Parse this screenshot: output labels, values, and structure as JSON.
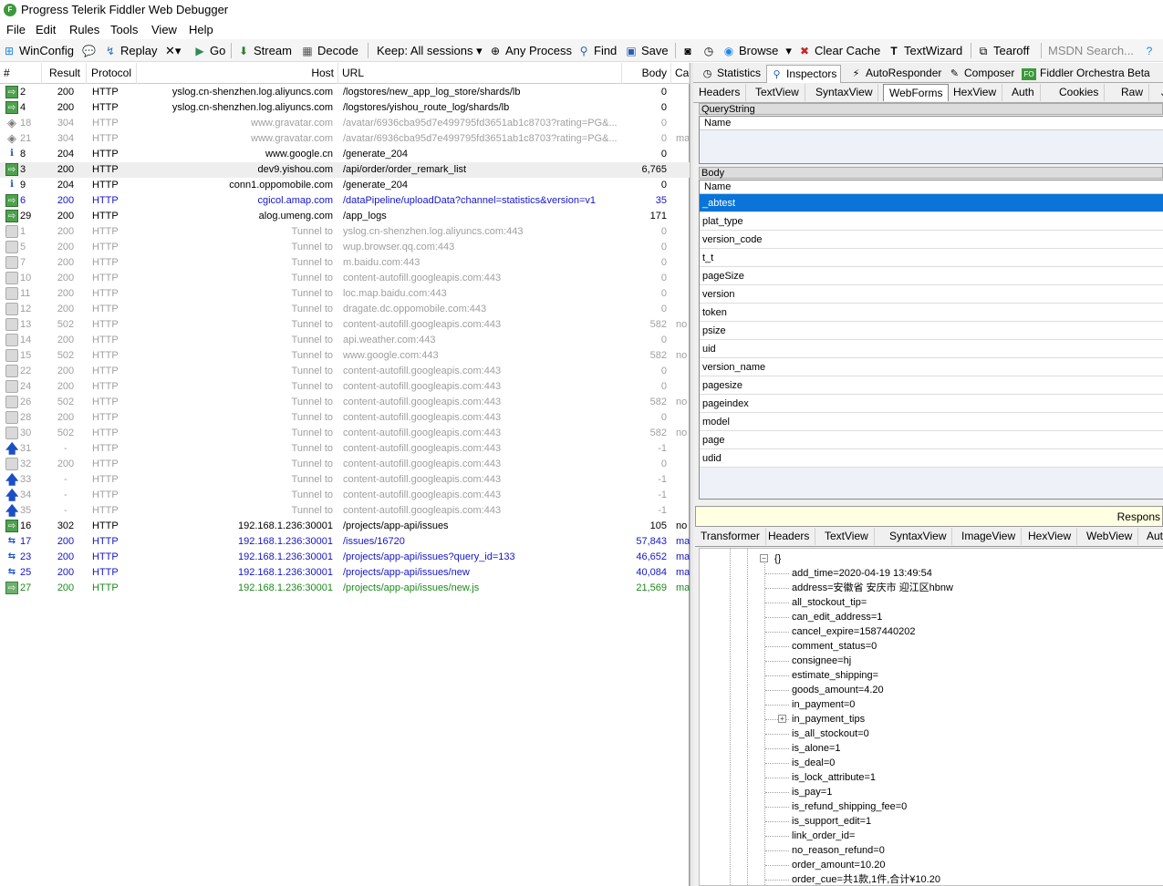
{
  "window": {
    "title": "Progress Telerik Fiddler Web Debugger",
    "icon": "F"
  },
  "menu": [
    "File",
    "Edit",
    "Rules",
    "Tools",
    "View",
    "Help"
  ],
  "toolbar": {
    "winconfig": "WinConfig",
    "replay": "Replay",
    "remove": "✕▾",
    "go": "Go",
    "stream": "Stream",
    "decode": "Decode",
    "keep": "Keep: All sessions ▾",
    "any_process": "Any Process",
    "find": "Find",
    "save": "Save",
    "browse": "Browse",
    "clear_cache": "Clear Cache",
    "textwizard": "TextWizard",
    "tearoff": "Tearoff",
    "msdn_search": "MSDN Search..."
  },
  "session_columns": [
    "#",
    "Result",
    "Protocol",
    "Host",
    "URL",
    "Body",
    "Ca"
  ],
  "sessions": [
    {
      "icon": "ok",
      "num": "2",
      "result": "200",
      "protocol": "HTTP",
      "host": "yslog.cn-shenzhen.log.aliyuncs.com",
      "url": "/logstores/new_app_log_store/shards/lb",
      "body": "0",
      "ca": "",
      "style": ""
    },
    {
      "icon": "ok",
      "num": "4",
      "result": "200",
      "protocol": "HTTP",
      "host": "yslog.cn-shenzhen.log.aliyuncs.com",
      "url": "/logstores/yishou_route_log/shards/lb",
      "body": "0",
      "ca": "",
      "style": ""
    },
    {
      "icon": "diamond",
      "num": "18",
      "result": "304",
      "protocol": "HTTP",
      "host": "www.gravatar.com",
      "url": "/avatar/6936cba95d7e499795fd3651ab1c8703?rating=PG&...",
      "body": "0",
      "ca": "",
      "style": "gray"
    },
    {
      "icon": "diamond",
      "num": "21",
      "result": "304",
      "protocol": "HTTP",
      "host": "www.gravatar.com",
      "url": "/avatar/6936cba95d7e499795fd3651ab1c8703?rating=PG&...",
      "body": "0",
      "ca": "ma",
      "style": "gray"
    },
    {
      "icon": "info",
      "num": "8",
      "result": "204",
      "protocol": "HTTP",
      "host": "www.google.cn",
      "url": "/generate_204",
      "body": "0",
      "ca": "",
      "style": ""
    },
    {
      "icon": "ok",
      "num": "3",
      "result": "200",
      "protocol": "HTTP",
      "host": "dev9.yishou.com",
      "url": "/api/order/order_remark_list",
      "body": "6,765",
      "ca": "",
      "style": "",
      "selected": true
    },
    {
      "icon": "info",
      "num": "9",
      "result": "204",
      "protocol": "HTTP",
      "host": "conn1.oppomobile.com",
      "url": "/generate_204",
      "body": "0",
      "ca": "",
      "style": ""
    },
    {
      "icon": "ok",
      "num": "6",
      "result": "200",
      "protocol": "HTTP",
      "host": "cgicol.amap.com",
      "url": "/dataPipeline/uploadData?channel=statistics&version=v1",
      "body": "35",
      "ca": "",
      "style": "blue"
    },
    {
      "icon": "ok",
      "num": "29",
      "result": "200",
      "protocol": "HTTP",
      "host": "alog.umeng.com",
      "url": "/app_logs",
      "body": "171",
      "ca": "",
      "style": ""
    },
    {
      "icon": "lock",
      "num": "1",
      "result": "200",
      "protocol": "HTTP",
      "host": "Tunnel to",
      "url": "yslog.cn-shenzhen.log.aliyuncs.com:443",
      "body": "0",
      "ca": "",
      "style": "gray"
    },
    {
      "icon": "lock",
      "num": "5",
      "result": "200",
      "protocol": "HTTP",
      "host": "Tunnel to",
      "url": "wup.browser.qq.com:443",
      "body": "0",
      "ca": "",
      "style": "gray"
    },
    {
      "icon": "lock",
      "num": "7",
      "result": "200",
      "protocol": "HTTP",
      "host": "Tunnel to",
      "url": "m.baidu.com:443",
      "body": "0",
      "ca": "",
      "style": "gray"
    },
    {
      "icon": "lock",
      "num": "10",
      "result": "200",
      "protocol": "HTTP",
      "host": "Tunnel to",
      "url": "content-autofill.googleapis.com:443",
      "body": "0",
      "ca": "",
      "style": "gray"
    },
    {
      "icon": "lock",
      "num": "11",
      "result": "200",
      "protocol": "HTTP",
      "host": "Tunnel to",
      "url": "loc.map.baidu.com:443",
      "body": "0",
      "ca": "",
      "style": "gray"
    },
    {
      "icon": "lock",
      "num": "12",
      "result": "200",
      "protocol": "HTTP",
      "host": "Tunnel to",
      "url": "dragate.dc.oppomobile.com:443",
      "body": "0",
      "ca": "",
      "style": "gray"
    },
    {
      "icon": "lock",
      "num": "13",
      "result": "502",
      "protocol": "HTTP",
      "host": "Tunnel to",
      "url": "content-autofill.googleapis.com:443",
      "body": "582",
      "ca": "no",
      "style": "gray"
    },
    {
      "icon": "lock",
      "num": "14",
      "result": "200",
      "protocol": "HTTP",
      "host": "Tunnel to",
      "url": "api.weather.com:443",
      "body": "0",
      "ca": "",
      "style": "gray"
    },
    {
      "icon": "lock",
      "num": "15",
      "result": "502",
      "protocol": "HTTP",
      "host": "Tunnel to",
      "url": "www.google.com:443",
      "body": "582",
      "ca": "no",
      "style": "gray"
    },
    {
      "icon": "lock",
      "num": "22",
      "result": "200",
      "protocol": "HTTP",
      "host": "Tunnel to",
      "url": "content-autofill.googleapis.com:443",
      "body": "0",
      "ca": "",
      "style": "gray"
    },
    {
      "icon": "lock",
      "num": "24",
      "result": "200",
      "protocol": "HTTP",
      "host": "Tunnel to",
      "url": "content-autofill.googleapis.com:443",
      "body": "0",
      "ca": "",
      "style": "gray"
    },
    {
      "icon": "lock",
      "num": "26",
      "result": "502",
      "protocol": "HTTP",
      "host": "Tunnel to",
      "url": "content-autofill.googleapis.com:443",
      "body": "582",
      "ca": "no",
      "style": "gray"
    },
    {
      "icon": "lock",
      "num": "28",
      "result": "200",
      "protocol": "HTTP",
      "host": "Tunnel to",
      "url": "content-autofill.googleapis.com:443",
      "body": "0",
      "ca": "",
      "style": "gray"
    },
    {
      "icon": "lock",
      "num": "30",
      "result": "502",
      "protocol": "HTTP",
      "host": "Tunnel to",
      "url": "content-autofill.googleapis.com:443",
      "body": "582",
      "ca": "no",
      "style": "gray"
    },
    {
      "icon": "up",
      "num": "31",
      "result": "-",
      "protocol": "HTTP",
      "host": "Tunnel to",
      "url": "content-autofill.googleapis.com:443",
      "body": "-1",
      "ca": "",
      "style": "gray"
    },
    {
      "icon": "lock",
      "num": "32",
      "result": "200",
      "protocol": "HTTP",
      "host": "Tunnel to",
      "url": "content-autofill.googleapis.com:443",
      "body": "0",
      "ca": "",
      "style": "gray"
    },
    {
      "icon": "up",
      "num": "33",
      "result": "-",
      "protocol": "HTTP",
      "host": "Tunnel to",
      "url": "content-autofill.googleapis.com:443",
      "body": "-1",
      "ca": "",
      "style": "gray"
    },
    {
      "icon": "up",
      "num": "34",
      "result": "-",
      "protocol": "HTTP",
      "host": "Tunnel to",
      "url": "content-autofill.googleapis.com:443",
      "body": "-1",
      "ca": "",
      "style": "gray"
    },
    {
      "icon": "up",
      "num": "35",
      "result": "-",
      "protocol": "HTTP",
      "host": "Tunnel to",
      "url": "content-autofill.googleapis.com:443",
      "body": "-1",
      "ca": "",
      "style": "gray"
    },
    {
      "icon": "ok",
      "num": "16",
      "result": "302",
      "protocol": "HTTP",
      "host": "192.168.1.236:30001",
      "url": "/projects/app-api/issues",
      "body": "105",
      "ca": "no",
      "style": ""
    },
    {
      "icon": "css",
      "num": "17",
      "result": "200",
      "protocol": "HTTP",
      "host": "192.168.1.236:30001",
      "url": "/issues/16720",
      "body": "57,843",
      "ca": "ma",
      "style": "blue"
    },
    {
      "icon": "css",
      "num": "23",
      "result": "200",
      "protocol": "HTTP",
      "host": "192.168.1.236:30001",
      "url": "/projects/app-api/issues?query_id=133",
      "body": "46,652",
      "ca": "ma",
      "style": "blue"
    },
    {
      "icon": "css",
      "num": "25",
      "result": "200",
      "protocol": "HTTP",
      "host": "192.168.1.236:30001",
      "url": "/projects/app-api/issues/new",
      "body": "40,084",
      "ca": "ma",
      "style": "blue"
    },
    {
      "icon": "js",
      "num": "27",
      "result": "200",
      "protocol": "HTTP",
      "host": "192.168.1.236:30001",
      "url": "/projects/app-api/issues/new.js",
      "body": "21,569",
      "ca": "ma",
      "style": "green"
    }
  ],
  "main_tabs": [
    "Statistics",
    "Inspectors",
    "AutoResponder",
    "Composer",
    "Fiddler Orchestra Beta"
  ],
  "fo_badge": "FO",
  "request_tabs": [
    "Headers",
    "TextView",
    "SyntaxView",
    "WebForms",
    "HexView",
    "Auth",
    "Cookies",
    "Raw",
    "J"
  ],
  "querystring": {
    "title": "QueryString",
    "col": "Name"
  },
  "body_section": {
    "title": "Body",
    "col": "Name",
    "rows": [
      "_abtest",
      "plat_type",
      "version_code",
      "t_t",
      "pageSize",
      "version",
      "token",
      "psize",
      "uid",
      "version_name",
      "pagesize",
      "pageindex",
      "model",
      "page",
      "udid"
    ]
  },
  "response_label": "Respons",
  "response_tabs": [
    "Transformer",
    "Headers",
    "TextView",
    "SyntaxView",
    "ImageView",
    "HexView",
    "WebView",
    "Aut"
  ],
  "json_tree": {
    "root": "{}",
    "items": [
      {
        "text": "add_time=2020-04-19 13:49:54",
        "expand": false
      },
      {
        "text": "address=安徽省 安庆市 迎江区hbnw",
        "expand": false
      },
      {
        "text": "all_stockout_tip=",
        "expand": false
      },
      {
        "text": "can_edit_address=1",
        "expand": false
      },
      {
        "text": "cancel_expire=1587440202",
        "expand": false
      },
      {
        "text": "comment_status=0",
        "expand": false
      },
      {
        "text": "consignee=hj",
        "expand": false
      },
      {
        "text": "estimate_shipping=",
        "expand": false
      },
      {
        "text": "goods_amount=4.20",
        "expand": false
      },
      {
        "text": "in_payment=0",
        "expand": false
      },
      {
        "text": "in_payment_tips",
        "expand": true
      },
      {
        "text": "is_all_stockout=0",
        "expand": false
      },
      {
        "text": "is_alone=1",
        "expand": false
      },
      {
        "text": "is_deal=0",
        "expand": false
      },
      {
        "text": "is_lock_attribute=1",
        "expand": false
      },
      {
        "text": "is_pay=1",
        "expand": false
      },
      {
        "text": "is_refund_shipping_fee=0",
        "expand": false
      },
      {
        "text": "is_support_edit=1",
        "expand": false
      },
      {
        "text": "link_order_id=",
        "expand": false
      },
      {
        "text": "no_reason_refund=0",
        "expand": false
      },
      {
        "text": "order_amount=10.20",
        "expand": false
      },
      {
        "text": "order_cue=共1款,1件,合计¥10.20",
        "expand": false
      }
    ]
  }
}
